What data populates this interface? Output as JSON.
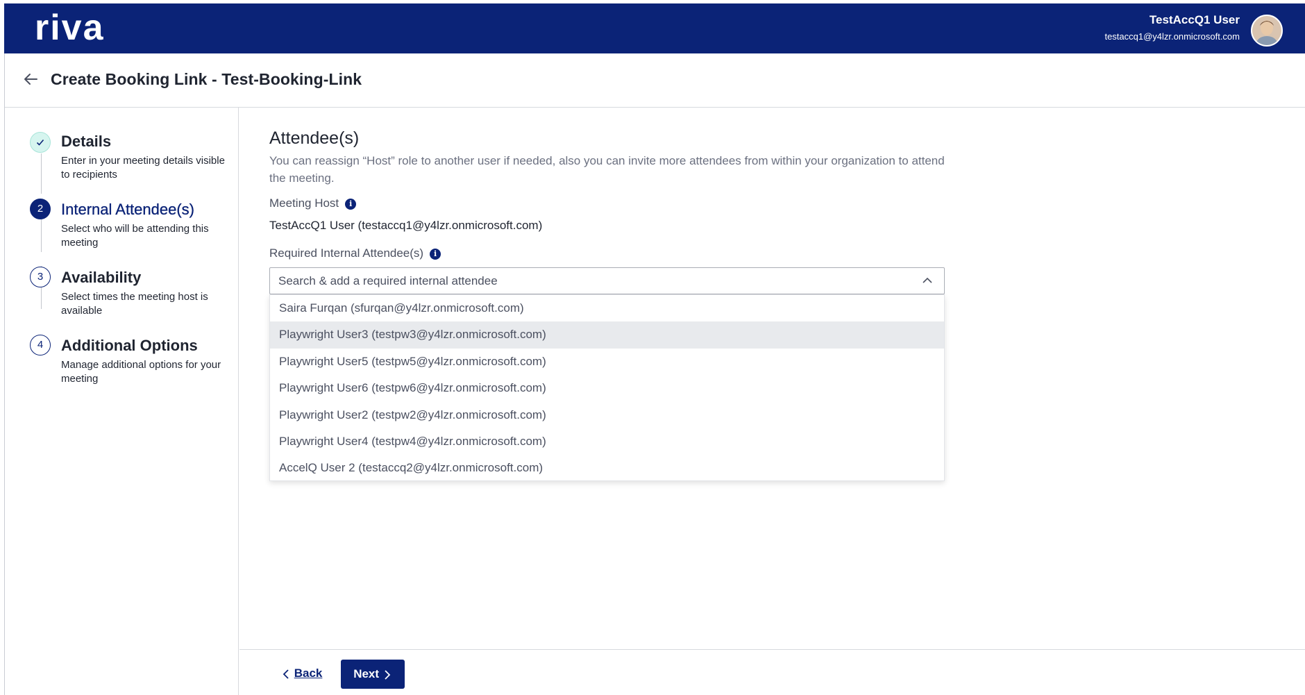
{
  "app": {
    "logo_text": "riva",
    "user_name": "TestAccQ1 User",
    "user_email": "testaccq1@y4lzr.onmicrosoft.com"
  },
  "header": {
    "title": "Create Booking Link - Test-Booking-Link"
  },
  "steps": [
    {
      "number": "✓",
      "title": "Details",
      "description": "Enter in your meeting details visible to recipients",
      "state": "done"
    },
    {
      "number": "2",
      "title": "Internal Attendee(s)",
      "description": "Select who will be attending this meeting",
      "state": "active"
    },
    {
      "number": "3",
      "title": "Availability",
      "description": "Select times the meeting host is available",
      "state": "todo"
    },
    {
      "number": "4",
      "title": "Additional Options",
      "description": "Manage additional options for your meeting",
      "state": "todo"
    }
  ],
  "main": {
    "title": "Attendee(s)",
    "description": "You can reassign “Host” role to another user if needed, also you can invite more attendees from within your organization to attend the meeting.",
    "host_label": "Meeting Host",
    "host_value": "TestAccQ1 User (testaccq1@y4lzr.onmicrosoft.com)",
    "required_label": "Required Internal Attendee(s)",
    "search_placeholder": "Search & add a required internal attendee",
    "options": [
      "Saira Furqan (sfurqan@y4lzr.onmicrosoft.com)",
      "Playwright User3 (testpw3@y4lzr.onmicrosoft.com)",
      "Playwright User5 (testpw5@y4lzr.onmicrosoft.com)",
      "Playwright User6 (testpw6@y4lzr.onmicrosoft.com)",
      "Playwright User2 (testpw2@y4lzr.onmicrosoft.com)",
      "Playwright User4 (testpw4@y4lzr.onmicrosoft.com)",
      "AccelQ User 2 (testaccq2@y4lzr.onmicrosoft.com)"
    ],
    "hovered_option_index": 1
  },
  "footer": {
    "back_label": "Back",
    "next_label": "Next"
  },
  "colors": {
    "brand": "#0b2377",
    "done_bg": "#d6f5ef",
    "hover_bg": "#e8eaed"
  }
}
